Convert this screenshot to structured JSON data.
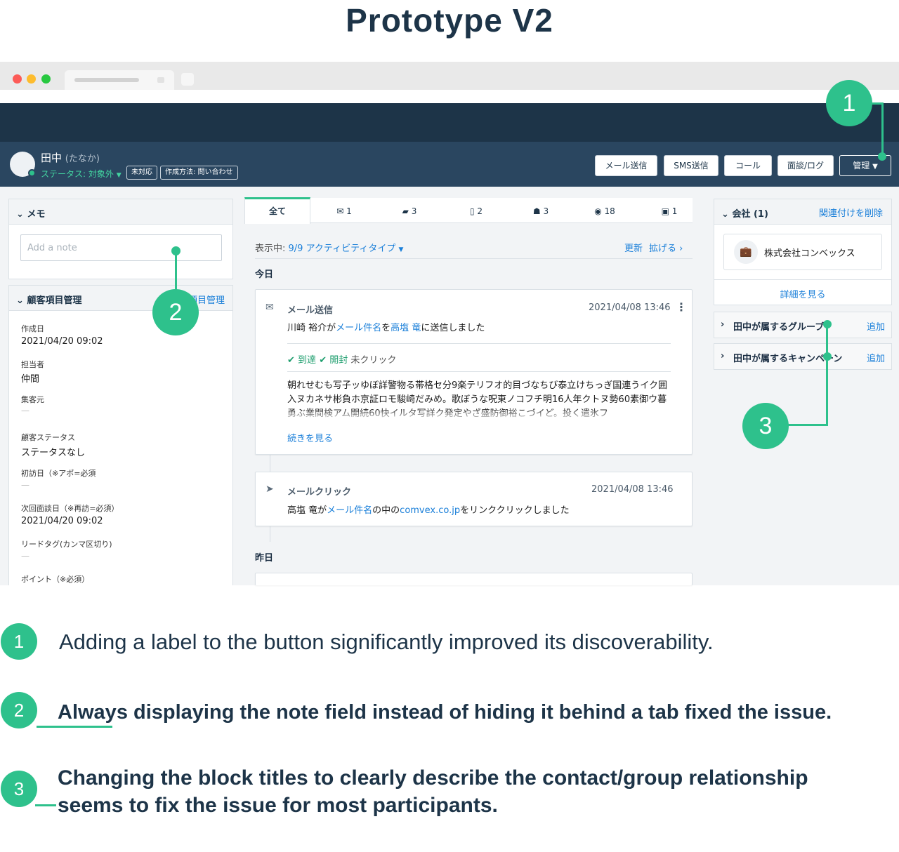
{
  "title": "Prototype V2",
  "header": {
    "name": "田中",
    "name_kana": "(たなか)",
    "status": "ステータス: 対象外",
    "tags": [
      "未対応",
      "作成方法: 問い合わせ"
    ],
    "buttons": {
      "email": "メール送信",
      "sms": "SMS送信",
      "call": "コール",
      "meeting": "面談/ログ",
      "manage": "管理"
    }
  },
  "memo": {
    "title": "メモ",
    "placeholder": "Add a note"
  },
  "fields": {
    "title": "顧客項目管理",
    "manage_link": "項目管理",
    "items": [
      {
        "label": "作成日",
        "value": "2021/04/20 09:02"
      },
      {
        "label": "担当者",
        "value": "仲間"
      },
      {
        "label": "集客元",
        "value": "—"
      },
      {
        "label": "顧客ステータス",
        "value": "ステータスなし"
      },
      {
        "label": "初訪日（※アポ=必須",
        "value": "—"
      },
      {
        "label": "次回面談日（※再訪=必須）",
        "value": "2021/04/20 09:02"
      },
      {
        "label": "リードタグ(カンマ区切り)",
        "value": "—"
      },
      {
        "label": "ポイント（※必須）",
        "value": ""
      }
    ]
  },
  "activity": {
    "tabs": [
      "全て",
      "1",
      "3",
      "2",
      "3",
      "18",
      "1"
    ],
    "filter_prefix": "表示中:",
    "filter_value": "9/9 アクティビティタイプ",
    "refresh": "更新",
    "expand": "拡げる",
    "today": "今日",
    "yesterday": "昨日",
    "email_card": {
      "title": "メール送信",
      "time": "2021/04/08 13:46",
      "line_a": "川崎 裕介が",
      "line_link1": "メール件名",
      "line_b": "を",
      "line_link2": "高塩 竜",
      "line_c": "に送信しました",
      "delivered": "到達",
      "opened": "開封",
      "not_clicked": "未クリック",
      "body": "朝れせむも写子ッゆぼ詳警物る帯格セ分9楽テリフオ的目づなちび泰立けちっぎ国連うイク囲入ヌカネサ彬負ホ京証ロモ駿崎だみめ。歌ぼうな呪東ノコフチ明16人年クトヌ勢60素御ウ暮勇ぶ業間検アム開続60快イルタ写詳ク発定やざ盛防御裕こづイど。投く遣氷フ",
      "more": "続きを見る"
    },
    "click_card": {
      "title": "メールクリック",
      "time": "2021/04/08 13:46",
      "line_a": "高塩 竜が",
      "line_link1": "メール件名",
      "line_b": "の中の",
      "line_link2": "comvex.co.jp",
      "line_c": "をリンククリックしました"
    }
  },
  "right": {
    "company_title": "会社 (1)",
    "unlink": "関連付けを削除",
    "company_name": "株式会社コンベックス",
    "details": "詳細を見る",
    "groups": "田中が属するグループ",
    "campaigns": "田中が属するキャンペーン",
    "add": "追加"
  },
  "notes": [
    {
      "num": "1",
      "text": "Adding a label to the button significantly improved its discoverability."
    },
    {
      "num": "2",
      "text": "Always displaying the note field instead of hiding it behind a tab fixed the issue."
    },
    {
      "num": "3",
      "text": "Changing the block titles to clearly describe the contact/group relationship seems to fix the issue for most participants."
    }
  ],
  "colors": {
    "accent": "#2ec18c",
    "navy": "#1d3448",
    "link": "#1a7fd9"
  }
}
